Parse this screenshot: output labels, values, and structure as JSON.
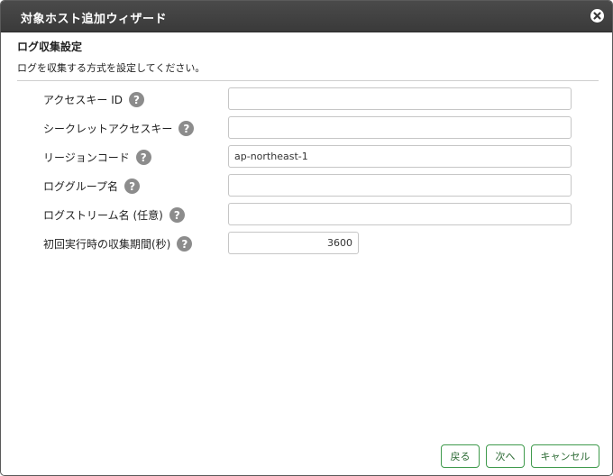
{
  "window": {
    "title": "対象ホスト追加ウィザード",
    "close_icon": "close-icon"
  },
  "section": {
    "title": "ログ収集設定",
    "description": "ログを収集する方式を設定してください。"
  },
  "fields": [
    {
      "label": "アクセスキー ID",
      "value": "",
      "placeholder": ""
    },
    {
      "label": "シークレットアクセスキー",
      "value": "",
      "placeholder": ""
    },
    {
      "label": "リージョンコード",
      "value": "ap-northeast-1",
      "placeholder": ""
    },
    {
      "label": "ロググループ名",
      "value": "",
      "placeholder": ""
    },
    {
      "label": "ログストリーム名 (任意)",
      "value": "",
      "placeholder": ""
    },
    {
      "label": "初回実行時の収集期間(秒)",
      "value": "3600",
      "placeholder": ""
    }
  ],
  "help_symbol": "?",
  "buttons": {
    "back": "戻る",
    "next": "次へ",
    "cancel": "キャンセル"
  },
  "colors": {
    "titlebar": "#404040",
    "help_icon": "#8c8c8c",
    "button_border": "#3f9a4c"
  }
}
